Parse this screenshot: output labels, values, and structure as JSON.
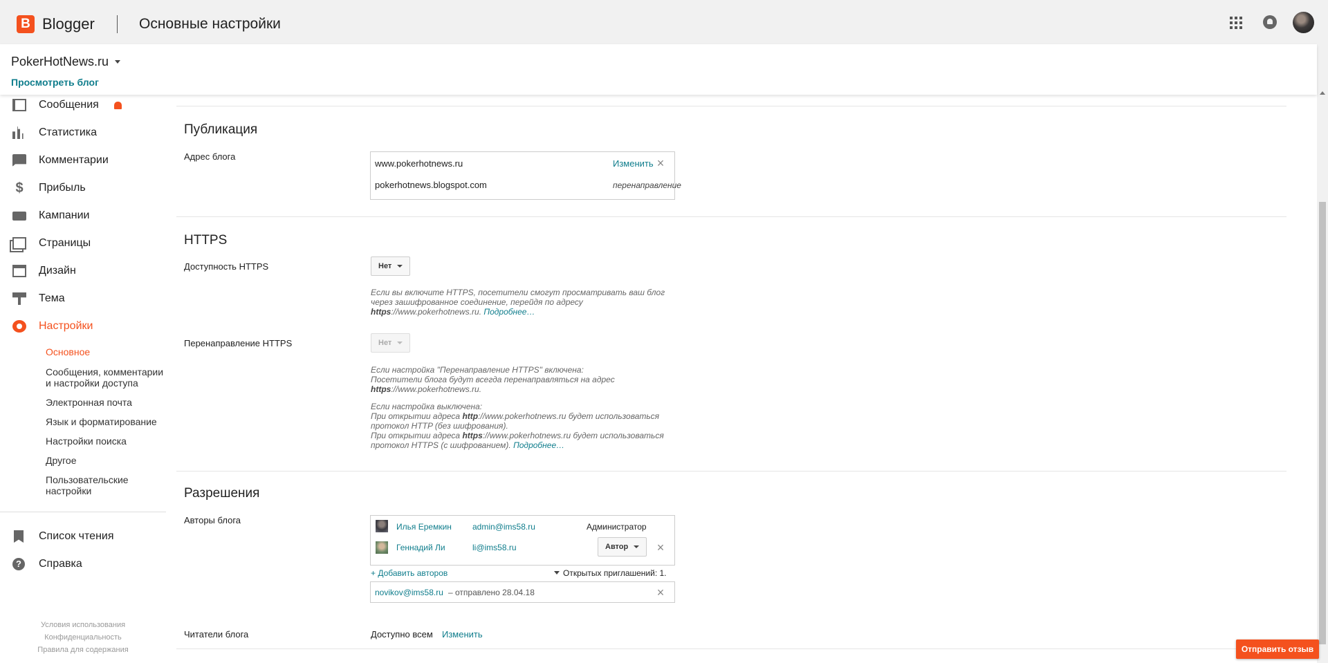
{
  "app": {
    "brand": "Blogger",
    "page_title": "Основные настройки"
  },
  "blog": {
    "name": "PokerHotNews.ru",
    "view_blog": "Просмотреть блог"
  },
  "sidebar": {
    "items": [
      {
        "label": "Сообщения",
        "icon": "posts-icon"
      },
      {
        "label": "Статистика",
        "icon": "stats-icon"
      },
      {
        "label": "Комментарии",
        "icon": "comments-icon"
      },
      {
        "label": "Прибыль",
        "icon": "dollar-icon"
      },
      {
        "label": "Кампании",
        "icon": "ads-icon"
      },
      {
        "label": "Страницы",
        "icon": "pages-icon"
      },
      {
        "label": "Дизайн",
        "icon": "layout-icon"
      },
      {
        "label": "Тема",
        "icon": "theme-icon"
      },
      {
        "label": "Настройки",
        "icon": "gear-icon"
      }
    ],
    "sub_items": [
      {
        "label": "Основное"
      },
      {
        "label": "Сообщения, комментарии и настройки доступа"
      },
      {
        "label": "Электронная почта"
      },
      {
        "label": "Язык и форматирование"
      },
      {
        "label": "Настройки поиска"
      },
      {
        "label": "Другое"
      },
      {
        "label": "Пользовательские настройки"
      }
    ],
    "reading_list": "Список чтения",
    "help": "Справка",
    "footer": {
      "terms": "Условия использования",
      "privacy": "Конфиденциальность",
      "content_policy": "Правила для содержания"
    }
  },
  "publishing": {
    "title": "Публикация",
    "address_label": "Адрес блога",
    "primary_address": "www.pokerhotnews.ru",
    "change": "Изменить",
    "secondary_address": "pokerhotnews.blogspot.com",
    "redirect": "перенаправление"
  },
  "https": {
    "title": "HTTPS",
    "availability_label": "Доступность HTTPS",
    "availability_value": "Нет",
    "availability_note_1": "Если вы включите HTTPS, посетители смогут просматривать ваш блог через зашифрованное соединение, перейдя по адресу",
    "availability_note_scheme": "https",
    "availability_note_url": "://www.pokerhotnews.ru.",
    "more": "Подробнее…",
    "redirect_label": "Перенаправление HTTPS",
    "redirect_value": "Нет",
    "redirect_note_on_1": "Если настройка \"Перенаправление HTTPS\" включена:",
    "redirect_note_on_2": "Посетители блога будут всегда перенаправляться на адрес",
    "redirect_note_on_scheme": "https",
    "redirect_note_on_url": "://www.pokerhotnews.ru.",
    "redirect_note_off_1": "Если настройка выключена:",
    "redirect_note_off_2a": "При открытии адреса",
    "redirect_note_off_2_scheme": "http",
    "redirect_note_off_2b": "://www.pokerhotnews.ru будет использоваться протокол HTTP (без шифрования).",
    "redirect_note_off_3a": "При открытии адреса",
    "redirect_note_off_3_scheme": "https",
    "redirect_note_off_3b": "://www.pokerhotnews.ru будет использоваться протокол HTTPS (с шифрованием)."
  },
  "permissions": {
    "title": "Разрешения",
    "authors_label": "Авторы блога",
    "authors": [
      {
        "name": "Илья Еремкин",
        "email": "admin@ims58.ru",
        "role": "Администратор"
      },
      {
        "name": "Геннадий Ли",
        "email": "li@ims58.ru",
        "role": "Автор"
      }
    ],
    "add_authors": "+ Добавить авторов",
    "open_invites": "Открытых приглашений: 1.",
    "invite_email": "novikov@ims58.ru",
    "invite_sent": "– отправлено 28.04.18",
    "readers_label": "Читатели блога",
    "readers_value": "Доступно всем",
    "readers_change": "Изменить"
  },
  "feedback": "Отправить отзыв",
  "colors": {
    "accent": "#f4511e",
    "link": "#0f7d8c"
  }
}
